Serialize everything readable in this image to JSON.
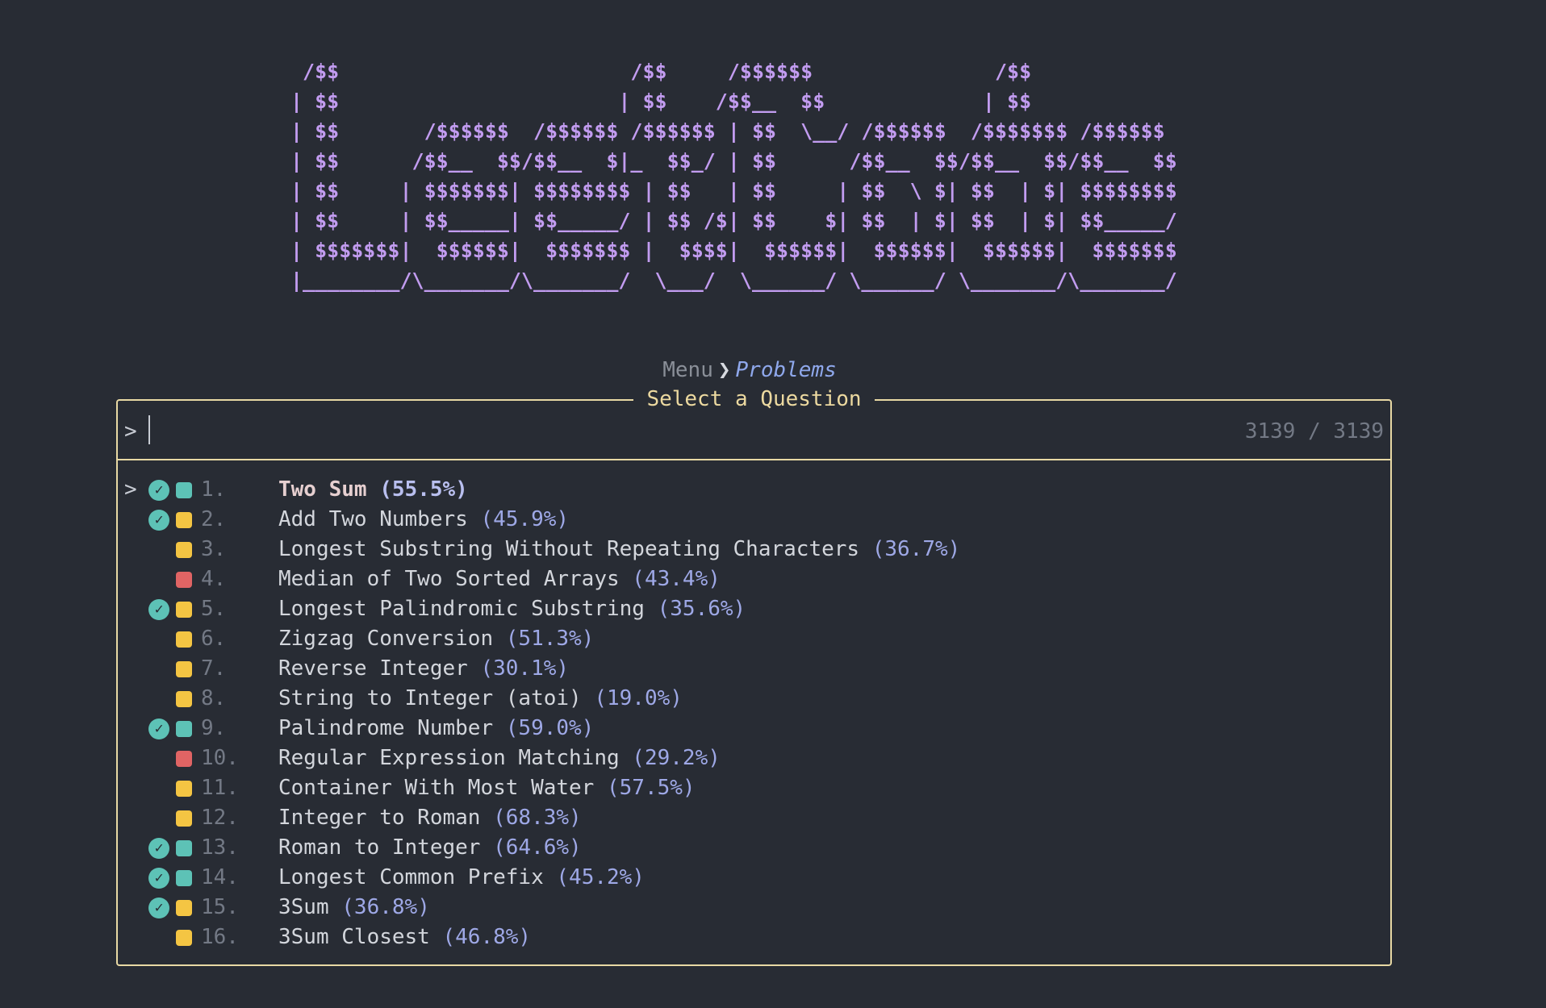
{
  "banner": {
    "lines": [
      " /$$                        /$$     /$$$$$$               /$$",
      "| $$                       | $$    /$$__  $$             | $$",
      "| $$       /$$$$$$  /$$$$$$ /$$$$$$ | $$  \\__/ /$$$$$$  /$$$$$$$ /$$$$$$",
      "| $$      /$$__  $$/$$__  $|_  $$_/ | $$      /$$__  $$/$$__  $$/$$__  $$",
      "| $$     | $$$$$$$| $$$$$$$$ | $$   | $$     | $$  \\ $| $$  | $| $$$$$$$$",
      "| $$     | $$_____| $$_____/ | $$ /$| $$    $| $$  | $| $$  | $| $$_____/",
      "| $$$$$$$|  $$$$$$|  $$$$$$$ |  $$$$|  $$$$$$|  $$$$$$|  $$$$$$|  $$$$$$$",
      "|________/\\_______/\\_______/  \\___/  \\______/ \\______/ \\_______/\\_______/"
    ]
  },
  "breadcrumb": {
    "menu": "Menu",
    "separator": "❯",
    "current": "Problems"
  },
  "picker": {
    "title": "Select a Question",
    "prompt": ">",
    "search_value": "",
    "counter": "3139 / 3139",
    "selector": ">"
  },
  "colors": {
    "easy": "#5dc2b6",
    "medium": "#f4c543",
    "hard": "#e06464",
    "solved_check": "#5dc2b6",
    "border": "#e8d9a4",
    "banner": "#c29cf0"
  },
  "problems": [
    {
      "num": "1.",
      "title": "Two Sum",
      "rate": "(55.5%)",
      "solved": true,
      "difficulty": "easy",
      "active": true
    },
    {
      "num": "2.",
      "title": "Add Two Numbers",
      "rate": "(45.9%)",
      "solved": true,
      "difficulty": "medium",
      "active": false
    },
    {
      "num": "3.",
      "title": "Longest Substring Without Repeating Characters",
      "rate": "(36.7%)",
      "solved": false,
      "difficulty": "medium",
      "active": false
    },
    {
      "num": "4.",
      "title": "Median of Two Sorted Arrays",
      "rate": "(43.4%)",
      "solved": false,
      "difficulty": "hard",
      "active": false
    },
    {
      "num": "5.",
      "title": "Longest Palindromic Substring",
      "rate": "(35.6%)",
      "solved": true,
      "difficulty": "medium",
      "active": false
    },
    {
      "num": "6.",
      "title": "Zigzag Conversion",
      "rate": "(51.3%)",
      "solved": false,
      "difficulty": "medium",
      "active": false
    },
    {
      "num": "7.",
      "title": "Reverse Integer",
      "rate": "(30.1%)",
      "solved": false,
      "difficulty": "medium",
      "active": false
    },
    {
      "num": "8.",
      "title": "String to Integer (atoi)",
      "rate": "(19.0%)",
      "solved": false,
      "difficulty": "medium",
      "active": false
    },
    {
      "num": "9.",
      "title": "Palindrome Number",
      "rate": "(59.0%)",
      "solved": true,
      "difficulty": "easy",
      "active": false
    },
    {
      "num": "10.",
      "title": "Regular Expression Matching",
      "rate": "(29.2%)",
      "solved": false,
      "difficulty": "hard",
      "active": false
    },
    {
      "num": "11.",
      "title": "Container With Most Water",
      "rate": "(57.5%)",
      "solved": false,
      "difficulty": "medium",
      "active": false
    },
    {
      "num": "12.",
      "title": "Integer to Roman",
      "rate": "(68.3%)",
      "solved": false,
      "difficulty": "medium",
      "active": false
    },
    {
      "num": "13.",
      "title": "Roman to Integer",
      "rate": "(64.6%)",
      "solved": true,
      "difficulty": "easy",
      "active": false
    },
    {
      "num": "14.",
      "title": "Longest Common Prefix",
      "rate": "(45.2%)",
      "solved": true,
      "difficulty": "easy",
      "active": false
    },
    {
      "num": "15.",
      "title": "3Sum",
      "rate": "(36.8%)",
      "solved": true,
      "difficulty": "medium",
      "active": false
    },
    {
      "num": "16.",
      "title": "3Sum Closest",
      "rate": "(46.8%)",
      "solved": false,
      "difficulty": "medium",
      "active": false
    }
  ]
}
